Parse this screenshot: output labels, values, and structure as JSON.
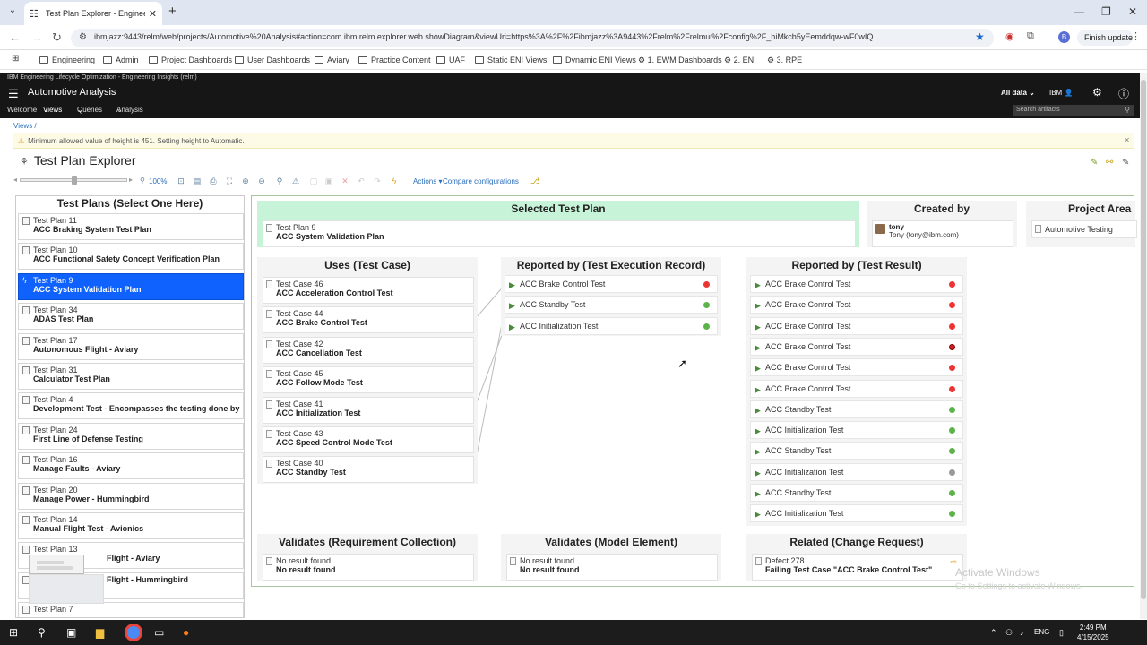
{
  "browser": {
    "tab_title": "Test Plan Explorer - Engineering",
    "url": "ibmjazz:9443/relm/web/projects/Automotive%20Analysis#action=com.ibm.relm.explorer.web.showDiagram&viewUri=https%3A%2F%2Fibmjazz%3A9443%2Frelm%2Frelmui%2Fconfig%2F_hiMkcb5yEemddqw-wF0wIQ",
    "finish_update": "Finish update",
    "profile_letter": "B",
    "bookmarks": [
      "Engineering",
      "Admin",
      "Project Dashboards",
      "User Dashboards",
      "Aviary",
      "Practice Content",
      "UAF",
      "Static ENI Views",
      "Dynamic ENI Views",
      "1. EWM Dashboards",
      "2. ENI",
      "3. RPE"
    ]
  },
  "app": {
    "top_caption": "IBM Engineering Lifecycle Optimization - Engineering Insights (relm)",
    "project_name": "Automotive Analysis",
    "all_data": "All data",
    "user_label": "IBM",
    "nav": [
      "Welcome",
      "Views",
      "Queries",
      "Analysis"
    ],
    "search_placeholder": "Search artifacts"
  },
  "breadcrumb": "Views /",
  "warning": "Minimum allowed value of height is 451. Setting height to Automatic.",
  "page_title": "Test Plan Explorer",
  "toolbar": {
    "zoom": "100%",
    "zoom_fraction": 0.5,
    "actions": "Actions",
    "compare": "Compare configurations"
  },
  "left_panel": {
    "title": "Test Plans (Select One Here)",
    "plans": [
      {
        "id": "Test Plan 11",
        "name": "ACC Braking System Test Plan",
        "selected": false
      },
      {
        "id": "Test Plan 10",
        "name": "ACC Functional Safety Concept Verification Plan",
        "selected": false
      },
      {
        "id": "Test Plan 9",
        "name": "ACC System Validation Plan",
        "selected": true
      },
      {
        "id": "Test Plan 34",
        "name": "ADAS Test Plan",
        "selected": false
      },
      {
        "id": "Test Plan 17",
        "name": "Autonomous Flight - Aviary",
        "selected": false
      },
      {
        "id": "Test Plan 31",
        "name": "Calculator Test Plan",
        "selected": false
      },
      {
        "id": "Test Plan 4",
        "name": "Development Test - Encompasses the testing done by",
        "selected": false
      },
      {
        "id": "Test Plan 24",
        "name": "First Line of Defense Testing",
        "selected": false
      },
      {
        "id": "Test Plan 16",
        "name": "Manage Faults - Aviary",
        "selected": false
      },
      {
        "id": "Test Plan 20",
        "name": "Manage Power - Hummingbird",
        "selected": false
      },
      {
        "id": "Test Plan 14",
        "name": "Manual Flight Test - Avionics",
        "selected": false
      },
      {
        "id": "Test Plan 13",
        "name": "Flight - Aviary",
        "selected": false
      },
      {
        "id": "",
        "name": "Flight - Hummingbird",
        "selected": false
      },
      {
        "id": "Test Plan 7",
        "name": "",
        "selected": false
      }
    ]
  },
  "selected_plan": {
    "header": "Selected Test Plan",
    "id": "Test Plan 9",
    "name": "ACC System Validation Plan"
  },
  "created_by": {
    "header": "Created by",
    "user": "tony",
    "email": "Tony (tony@ibm.com)"
  },
  "project_area": {
    "header": "Project Area",
    "name": "Automotive Testing"
  },
  "uses": {
    "header": "Uses (Test Case)",
    "items": [
      {
        "id": "Test Case 46",
        "name": "ACC Acceleration Control Test"
      },
      {
        "id": "Test Case 44",
        "name": "ACC Brake Control Test"
      },
      {
        "id": "Test Case 42",
        "name": "ACC Cancellation Test"
      },
      {
        "id": "Test Case 45",
        "name": "ACC Follow Mode Test"
      },
      {
        "id": "Test Case 41",
        "name": "ACC Initialization Test"
      },
      {
        "id": "Test Case 43",
        "name": "ACC Speed Control Mode Test"
      },
      {
        "id": "Test Case 40",
        "name": "ACC Standby Test"
      }
    ]
  },
  "execution_records": {
    "header": "Reported by (Test Execution Record)",
    "items": [
      {
        "name": "ACC Brake Control Test",
        "status": "red"
      },
      {
        "name": "ACC Standby Test",
        "status": "green"
      },
      {
        "name": "ACC Initialization Test",
        "status": "green"
      }
    ]
  },
  "test_results": {
    "header": "Reported by (Test Result)",
    "items": [
      {
        "name": "ACC Brake Control Test",
        "status": "red"
      },
      {
        "name": "ACC Brake Control Test",
        "status": "red"
      },
      {
        "name": "ACC Brake Control Test",
        "status": "red"
      },
      {
        "name": "ACC Brake Control Test",
        "status": "dred"
      },
      {
        "name": "ACC Brake Control Test",
        "status": "red"
      },
      {
        "name": "ACC Brake Control Test",
        "status": "red"
      },
      {
        "name": "ACC Standby Test",
        "status": "green"
      },
      {
        "name": "ACC Initialization Test",
        "status": "green"
      },
      {
        "name": "ACC Standby Test",
        "status": "green"
      },
      {
        "name": "ACC Initialization Test",
        "status": "grey"
      },
      {
        "name": "ACC Standby Test",
        "status": "green"
      },
      {
        "name": "ACC Initialization Test",
        "status": "green"
      }
    ]
  },
  "validates_req": {
    "header": "Validates (Requirement Collection)",
    "line1": "No result found",
    "line2": "No result found"
  },
  "validates_model": {
    "header": "Validates (Model Element)",
    "line1": "No result found",
    "line2": "No result found"
  },
  "related": {
    "header": "Related (Change Request)",
    "id": "Defect 278",
    "name": "Failing Test Case \"ACC Brake Control Test\""
  },
  "watermark": {
    "line1": "Activate Windows",
    "line2": "Go to Settings to activate Windows."
  },
  "taskbar": {
    "lang": "ENG",
    "time": "2:49 PM",
    "date": "4/15/2025"
  },
  "colors": {
    "selected": "#0f62fe",
    "selected_header": "#c7f4d8",
    "app_header": "#161616"
  }
}
